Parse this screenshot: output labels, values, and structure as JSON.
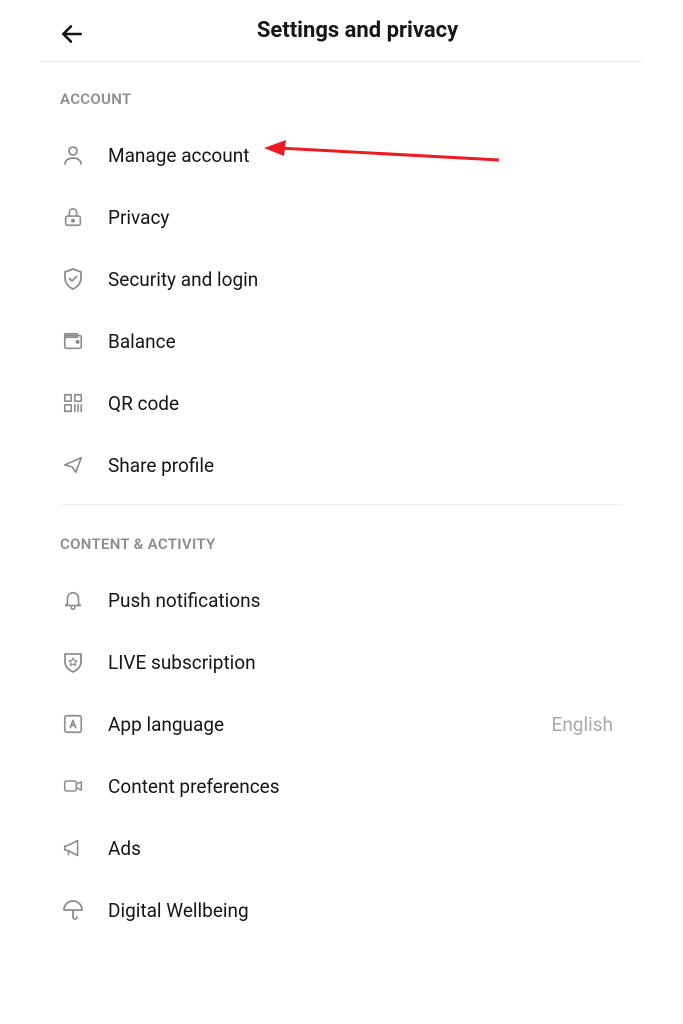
{
  "header": {
    "title": "Settings and privacy"
  },
  "sections": {
    "account": {
      "header": "ACCOUNT",
      "items": [
        {
          "label": "Manage account"
        },
        {
          "label": "Privacy"
        },
        {
          "label": "Security and login"
        },
        {
          "label": "Balance"
        },
        {
          "label": "QR code"
        },
        {
          "label": "Share profile"
        }
      ]
    },
    "content_activity": {
      "header": "CONTENT & ACTIVITY",
      "items": [
        {
          "label": "Push notifications"
        },
        {
          "label": "LIVE subscription"
        },
        {
          "label": "App language",
          "value": "English"
        },
        {
          "label": "Content preferences"
        },
        {
          "label": "Ads"
        },
        {
          "label": "Digital Wellbeing"
        }
      ]
    }
  }
}
